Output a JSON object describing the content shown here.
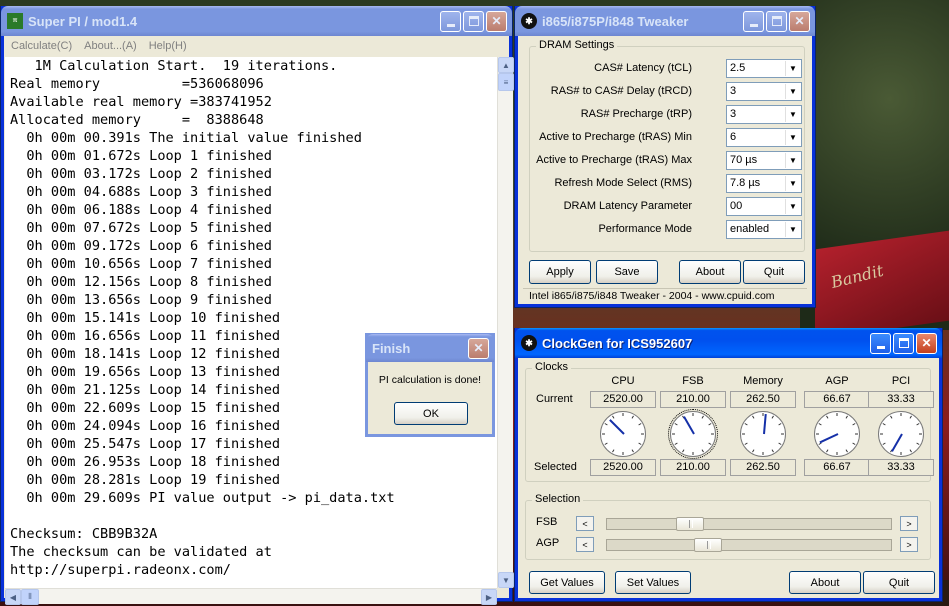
{
  "superpi": {
    "title": "Super PI / mod1.4",
    "icon_text": "SUPER π",
    "menu": [
      "Calculate(C)",
      "About...(A)",
      "Help(H)"
    ],
    "console_lines": [
      "   1M Calculation Start.  19 iterations.",
      "Real memory          =536068096",
      "Available real memory =383741952",
      "Allocated memory     =  8388648",
      "  0h 00m 00.391s The initial value finished",
      "  0h 00m 01.672s Loop 1 finished",
      "  0h 00m 03.172s Loop 2 finished",
      "  0h 00m 04.688s Loop 3 finished",
      "  0h 00m 06.188s Loop 4 finished",
      "  0h 00m 07.672s Loop 5 finished",
      "  0h 00m 09.172s Loop 6 finished",
      "  0h 00m 10.656s Loop 7 finished",
      "  0h 00m 12.156s Loop 8 finished",
      "  0h 00m 13.656s Loop 9 finished",
      "  0h 00m 15.141s Loop 10 finished",
      "  0h 00m 16.656s Loop 11 finished",
      "  0h 00m 18.141s Loop 12 finished",
      "  0h 00m 19.656s Loop 13 finished",
      "  0h 00m 21.125s Loop 14 finished",
      "  0h 00m 22.609s Loop 15 finished",
      "  0h 00m 24.094s Loop 16 finished",
      "  0h 00m 25.547s Loop 17 finished",
      "  0h 00m 26.953s Loop 18 finished",
      "  0h 00m 28.281s Loop 19 finished",
      "  0h 00m 29.609s PI value output -> pi_data.txt",
      "",
      "Checksum: CBB9B32A",
      "The checksum can be validated at",
      "http://superpi.radeonx.com/"
    ]
  },
  "finish_dialog": {
    "title": "Finish",
    "message": "PI calculation is done!",
    "ok_label": "OK"
  },
  "tweaker": {
    "title": "i865/i875P/i848 Tweaker",
    "group_label": "DRAM Settings",
    "rows": [
      {
        "label": "CAS# Latency (tCL)",
        "value": "2.5"
      },
      {
        "label": "RAS# to CAS# Delay (tRCD)",
        "value": "3"
      },
      {
        "label": "RAS# Precharge (tRP)",
        "value": "3"
      },
      {
        "label": "Active to Precharge (tRAS) Min",
        "value": "6"
      },
      {
        "label": "Active to Precharge (tRAS) Max",
        "value": "70 µs"
      },
      {
        "label": "Refresh Mode Select (RMS)",
        "value": "7.8 µs"
      },
      {
        "label": "DRAM Latency Parameter",
        "value": "00"
      },
      {
        "label": "Performance Mode",
        "value": "enabled"
      }
    ],
    "buttons": {
      "apply": "Apply",
      "save": "Save",
      "about": "About",
      "quit": "Quit"
    },
    "footer": "Intel i865/i875/i848 Tweaker - 2004 - www.cpuid.com"
  },
  "clockgen": {
    "title": "ClockGen for ICS952607",
    "clocks_label": "Clocks",
    "columns": [
      "CPU",
      "FSB",
      "Memory",
      "AGP",
      "PCI"
    ],
    "current_label": "Current",
    "selected_label": "Selected",
    "current": [
      "2520.00",
      "210.00",
      "262.50",
      "66.67",
      "33.33"
    ],
    "selected": [
      "2520.00",
      "210.00",
      "262.50",
      "66.67",
      "33.33"
    ],
    "dial_angles_deg": [
      -45,
      -30,
      5,
      245,
      210
    ],
    "selection_label": "Selection",
    "fsb_label": "FSB",
    "agp_label": "AGP",
    "fsb_slider_fraction": 0.27,
    "agp_slider_fraction": 0.34,
    "buttons": {
      "get": "Get Values",
      "set": "Set Values",
      "about": "About",
      "quit": "Quit"
    }
  },
  "colors": {
    "xp_blue": "#0053ee",
    "dialog_hand": "#1530a8",
    "console_bg": "#ffffff"
  }
}
